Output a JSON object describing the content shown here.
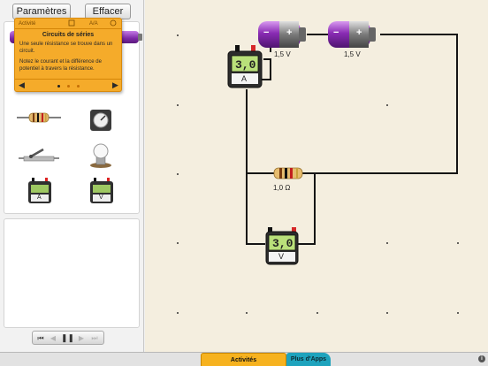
{
  "toolbar": {
    "settings_label": "Paramètres",
    "clear_label": "Effacer"
  },
  "help": {
    "tab_activity": "Activité",
    "tab_text_size": "A/A",
    "title": "Circuits de séries",
    "text1": "Une seule résistance se trouve dans un circuit.",
    "text2": "Notez le courant et la différence de potentiel à travers la résistance.",
    "prev_arrow": "◀",
    "next_arrow": "▶"
  },
  "circuit": {
    "battery1_label": "1,5 V",
    "battery2_label": "1,5 V",
    "resistor_label": "1,0 Ω",
    "ammeter_reading": "3,0",
    "ammeter_unit": "A",
    "voltmeter_reading": "3,0",
    "voltmeter_unit": "V"
  },
  "palette": {
    "ammeter_unit": "A",
    "voltmeter_unit": "V"
  },
  "battery_signs": {
    "minus": "−",
    "plus": "+"
  },
  "playback": {
    "rewind": "⏮",
    "step_back": "◀",
    "pause": "❚❚",
    "step_forward": "▶",
    "fast_forward": "⏭"
  },
  "bottom_tabs": {
    "activities": "Activités",
    "more_apps": "Plus d'Apps"
  },
  "info_icon_label": "i",
  "colors": {
    "battery_purple": "#7d28a6",
    "help_orange": "#f5ab2a",
    "meter_display": "#b9e07a",
    "activities_tab": "#f6b21f",
    "more_apps_tab": "#1ea3bd"
  }
}
